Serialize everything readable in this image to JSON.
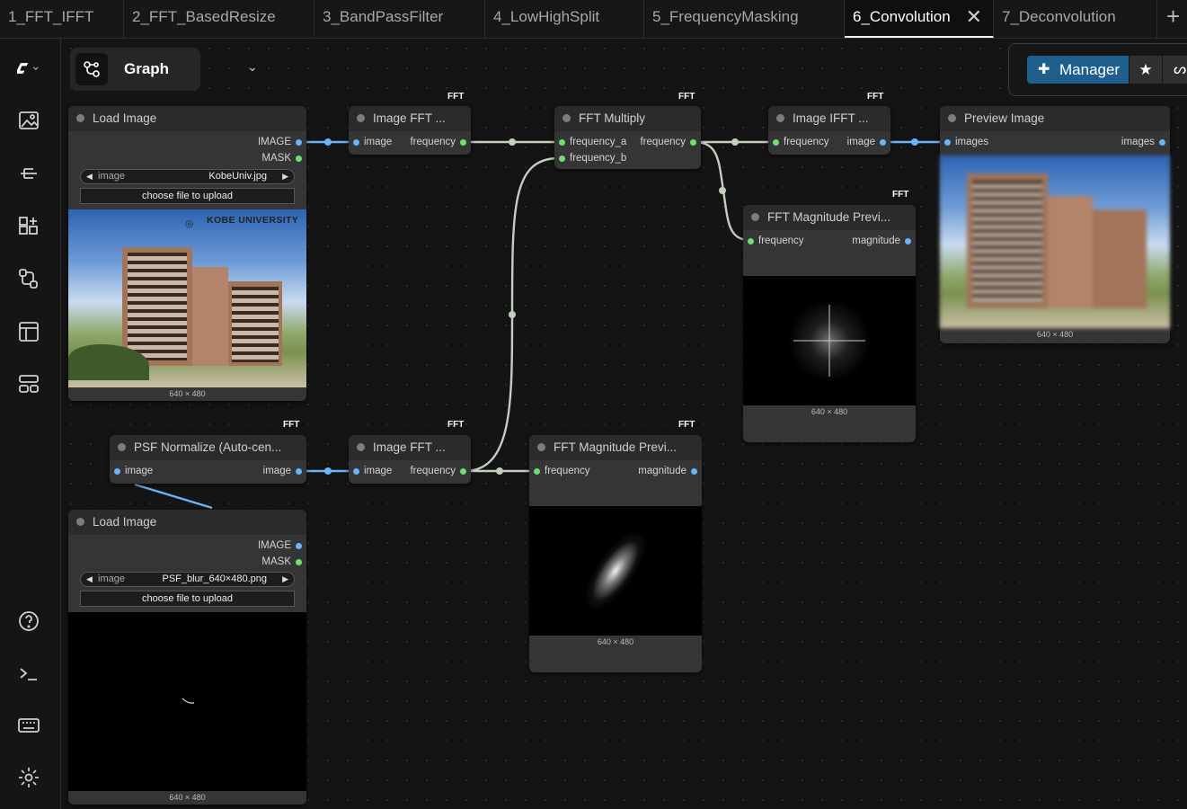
{
  "tabs": [
    {
      "label": "1_FFT_IFFT"
    },
    {
      "label": "2_FFT_BasedResize"
    },
    {
      "label": "3_BandPassFilter"
    },
    {
      "label": "4_LowHighSplit"
    },
    {
      "label": "5_FrequencyMasking"
    },
    {
      "label": "6_Convolution",
      "active": true
    },
    {
      "label": "7_Deconvolution"
    }
  ],
  "graph_menu": {
    "label": "Graph"
  },
  "toolbar": {
    "manager_label": "Manager"
  },
  "nodes": {
    "load_image_1": {
      "title": "Load Image",
      "outputs": [
        "IMAGE",
        "MASK"
      ],
      "widget_label": "image",
      "widget_value": "KobeUniv.jpg",
      "upload_label": "choose file to upload",
      "watermark": "KOBE UNIVERSITY",
      "dims": "640 × 480"
    },
    "image_fft_1": {
      "title": "Image FFT ...",
      "badge": "FFT",
      "input": "image",
      "output": "frequency"
    },
    "fft_multiply": {
      "title": "FFT Multiply",
      "badge": "FFT",
      "inputs": [
        "frequency_a",
        "frequency_b"
      ],
      "output": "frequency"
    },
    "image_ifft": {
      "title": "Image IFFT ...",
      "badge": "FFT",
      "input": "frequency",
      "output": "image"
    },
    "preview_image": {
      "title": "Preview Image",
      "input": "images",
      "output": "images",
      "dims": "640 × 480"
    },
    "fft_mag_1": {
      "title": "FFT Magnitude Previ...",
      "badge": "FFT",
      "input": "frequency",
      "output": "magnitude",
      "dims": "640 × 480"
    },
    "psf_normalize": {
      "title": "PSF Normalize (Auto-cen...",
      "badge": "FFT",
      "input": "image",
      "output": "image"
    },
    "image_fft_2": {
      "title": "Image FFT ...",
      "badge": "FFT",
      "input": "image",
      "output": "frequency"
    },
    "fft_mag_2": {
      "title": "FFT Magnitude Previ...",
      "badge": "FFT",
      "input": "frequency",
      "output": "magnitude",
      "dims": "640 × 480"
    },
    "load_image_2": {
      "title": "Load Image",
      "outputs": [
        "IMAGE",
        "MASK"
      ],
      "widget_label": "image",
      "widget_value": "PSF_blur_640×480.png",
      "upload_label": "choose file to upload",
      "dims": "640 × 480"
    }
  },
  "colors": {
    "image_link": "#6ab4f7",
    "frequency_link": "#c3cfbe",
    "accent": "#1e5f8d"
  }
}
